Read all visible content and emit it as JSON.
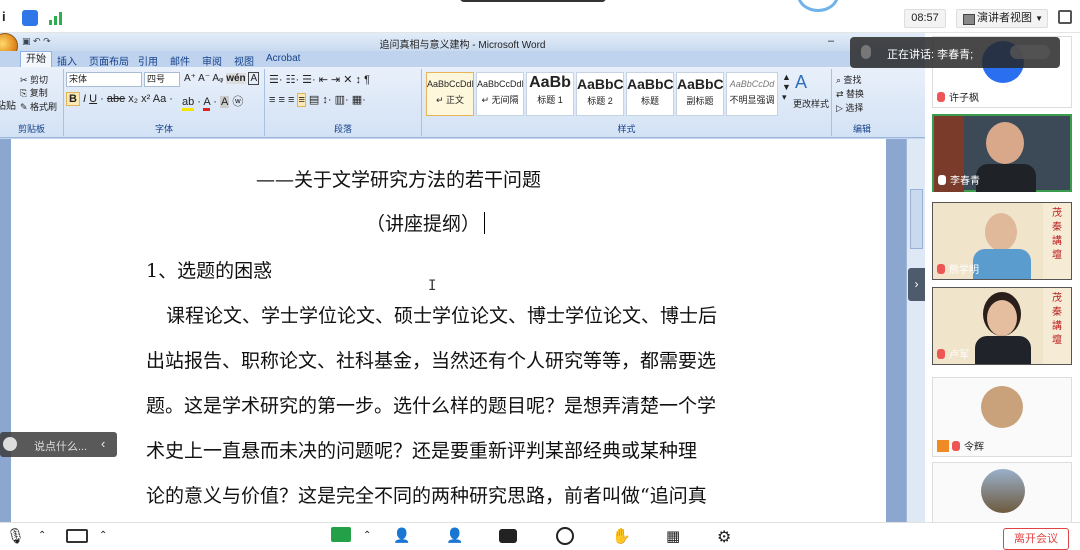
{
  "meeting": {
    "time": "08:57",
    "presenter_view": "演讲者视图",
    "speaking_prefix": "正在讲话: ",
    "speaking_name": "李春青;",
    "chat_placeholder": "说点什么...",
    "leave_label": "离开会议"
  },
  "word": {
    "title": "追问真相与意义建构 - Microsoft Word",
    "tabs": [
      "开始",
      "插入",
      "页面布局",
      "引用",
      "邮件",
      "审阅",
      "视图",
      "Acrobat"
    ],
    "clipboard": {
      "cut": "剪切",
      "copy": "复制",
      "painter": "格式刷",
      "paste": "粘贴",
      "group": "剪贴板"
    },
    "font": {
      "name": "宋体",
      "size": "四号",
      "group": "字体"
    },
    "paragraph_group": "段落",
    "styles_group": "样式",
    "editing": {
      "find": "查找",
      "replace": "替换",
      "select": "选择",
      "group": "编辑"
    },
    "change_styles": "更改样式",
    "styles": [
      {
        "preview": "AaBbCcDdI",
        "label": "↵ 正文"
      },
      {
        "preview": "AaBbCcDdI",
        "label": "↵ 无间隔"
      },
      {
        "preview": "AaBb",
        "label": "标题 1"
      },
      {
        "preview": "AaBbC",
        "label": "标题 2"
      },
      {
        "preview": "AaBbC",
        "label": "标题"
      },
      {
        "preview": "AaBbC",
        "label": "副标题"
      },
      {
        "preview": "AaBbCcDd",
        "label": "不明显强调"
      }
    ]
  },
  "document": {
    "subtitle": "——关于文学研究方法的若干问题",
    "outline": "（讲座提纲）",
    "section1": "1、选题的困惑",
    "lines": [
      "课程论文、学士学位论文、硕士学位论文、博士学位论文、博士后",
      "出站报告、职称论文、社科基金，当然还有个人研究等等，都需要选",
      "题。这是学术研究的第一步。选什么样的题目呢？是想弄清楚一个学",
      "术史上一直悬而未决的问题呢？还是要重新评判某部经典或某种理",
      "论的意义与价值？这是完全不同的两种研究思路，前者叫做“追问真"
    ]
  },
  "participants": [
    {
      "name": "许子枫"
    },
    {
      "name": "李春青"
    },
    {
      "name": "熊学明"
    },
    {
      "name": "卢军"
    },
    {
      "name": "令辉"
    },
    {
      "name": ""
    }
  ],
  "banner_text": [
    "茂",
    "秦",
    "講",
    "壇"
  ]
}
